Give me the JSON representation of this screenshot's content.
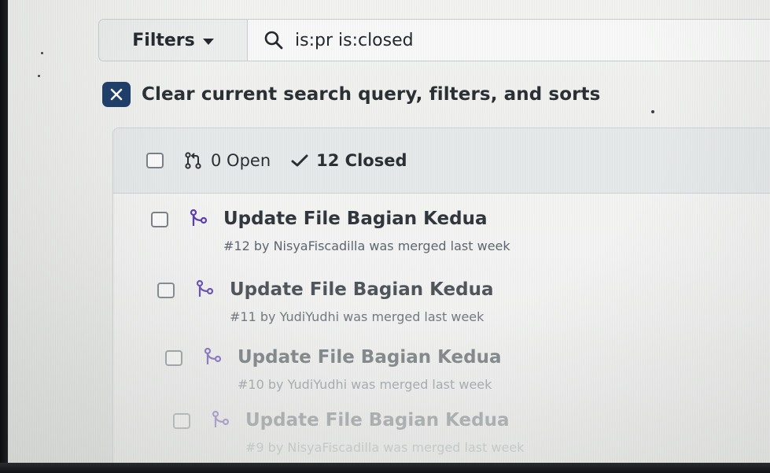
{
  "search_bar": {
    "filters_label": "Filters",
    "query": "is:pr is:closed"
  },
  "clear_query": {
    "label": "Clear current search query, filters, and sorts"
  },
  "list_header": {
    "open_label": "0 Open",
    "closed_label": "12 Closed"
  },
  "pull_requests": [
    {
      "title": "Update File Bagian Kedua",
      "meta": "#12 by NisyaFiscadilla was merged last week"
    },
    {
      "title": "Update File Bagian Kedua",
      "meta": "#11 by YudiYudhi was merged last week"
    },
    {
      "title": "Update File Bagian Kedua",
      "meta": "#10 by YudiYudhi was merged last week"
    },
    {
      "title": "Update File Bagian Kedua",
      "meta": "#9 by NisyaFiscadilla was merged last week"
    }
  ],
  "icons": {
    "search": "search-icon",
    "caret": "chevron-down-icon",
    "clear": "close-icon",
    "open": "git-pull-request-icon",
    "closed": "check-icon",
    "merged": "git-merge-icon"
  },
  "colors": {
    "clear_button": "#1c3d6a",
    "merged_icon": "#5a3fae",
    "text": "#24292f"
  }
}
